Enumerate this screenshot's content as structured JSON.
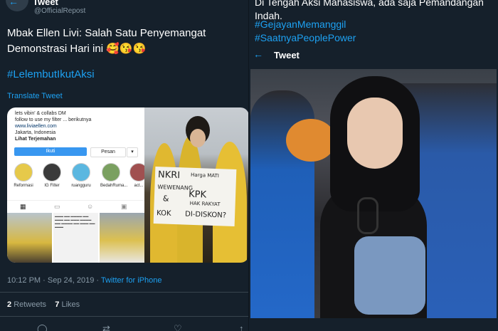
{
  "left": {
    "header_title": "Tweet",
    "handle": "@OfficialRepost",
    "tweet_text": "Mbak Ellen Livi: Salah Satu Penyemangat Demonstrasi Hari ini 🥰😘😘",
    "hashtag": "#LelembutIkutAksi",
    "translate_label": "Translate Tweet",
    "instagram": {
      "bio_lines": [
        "lets vibin' & collabs DM",
        "follow to use my filter ... berikutnya",
        "www.liviaellen.com",
        "Jakarta, Indonesia",
        "Lihat Terjemahan"
      ],
      "follow_label": "Ikuti",
      "message_label": "Pesan",
      "more_label": "▾",
      "highlights": [
        "Reformasi",
        "IG Filter",
        "ruangguru",
        "BedahRuma...",
        "act..."
      ]
    },
    "sign_text": {
      "line1": "NKRI",
      "line1b": "Harga MATI",
      "line2": "WEWENANG",
      "line3": "KPK",
      "line3b": "HAK RAKYAT",
      "line4": "&",
      "line5": "KOK",
      "line6": "DI-DISKON?"
    },
    "timestamp": "10:12 PM · Sep 24, 2019 · ",
    "source": "Twitter for iPhone",
    "retweets_count": "2",
    "retweets_label": "Retweets",
    "likes_count": "7",
    "likes_label": "Likes"
  },
  "right": {
    "text_top": "Di Tengah Aksi Mahasiswa, ada saja Pemandangan Indah.",
    "hashtag1": "#GejayanMemanggil",
    "hashtag2": "#SaatnyaPeoplePower",
    "header_title": "Tweet"
  },
  "colors": {
    "background": "#15202b",
    "accent": "#1da1f2",
    "muted": "#8899a6"
  },
  "icons": [
    "back-arrow-icon",
    "reply-icon",
    "retweet-icon",
    "like-icon",
    "share-icon"
  ]
}
